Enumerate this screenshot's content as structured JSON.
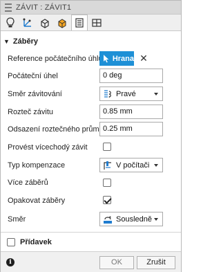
{
  "title": "ZÁVIT : ZÁVIT1",
  "tabs": [
    {
      "icon": "light-bulb-icon"
    },
    {
      "icon": "sketch-axes-icon"
    },
    {
      "icon": "box-icon"
    },
    {
      "icon": "appearance-icon"
    },
    {
      "icon": "feature-dialog-icon",
      "active": true
    },
    {
      "icon": "layout-icon"
    }
  ],
  "sections": {
    "main": {
      "label": "Záběry",
      "expanded": true
    },
    "extra": {
      "label": "Přídavek",
      "checked": false
    }
  },
  "fields": {
    "reference": {
      "label": "Reference počátečního úhlu",
      "button": "Hrana"
    },
    "start_angle": {
      "label": "Počáteční úhel",
      "value": "0 deg"
    },
    "direction": {
      "label": "Směr závitování",
      "value": "Pravé",
      "icon": "right-hand-thread-icon"
    },
    "pitch": {
      "label": "Rozteč závitu",
      "value": "0.85 mm"
    },
    "offset": {
      "label": "Odsazení roztečného průměru",
      "value": "0.25 mm"
    },
    "multi_start": {
      "label": "Provést vícechodý závit",
      "checked": false
    },
    "compensation": {
      "label": "Typ kompenzace",
      "value": "V počítači",
      "icon": "compensation-icon"
    },
    "multiple_passes": {
      "label": "Více záběrů",
      "checked": false
    },
    "repeat_passes": {
      "label": "Opakovat záběry",
      "checked": true
    },
    "cut_direction": {
      "label": "Směr",
      "value": "Sousledně",
      "icon": "climb-milling-icon"
    }
  },
  "footer": {
    "ok": "OK",
    "cancel": "Zrušit",
    "info_icon": "info-icon"
  }
}
